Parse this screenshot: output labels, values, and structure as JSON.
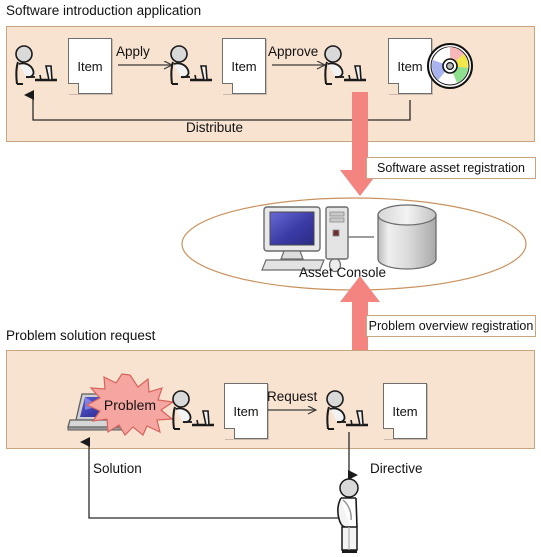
{
  "diagram": {
    "title_top": "Software introduction application",
    "title_bottom": "Problem solution request",
    "colors": {
      "panel_fill": "#f8e3d1",
      "panel_border": "#c9a57e",
      "big_arrow": "#f4847f",
      "ellipse_stroke": "#c9925e",
      "line": "#3a3a3a",
      "doc_fill": "#ffffff",
      "screen_blue": "#3c3ca8",
      "starburst": "#f6a6a0"
    }
  },
  "top_panel": {
    "label": "Software introduction application",
    "nodes": [
      {
        "name": "requester",
        "type": "person-at-desk"
      },
      {
        "name": "item-1",
        "type": "document",
        "label": "Item"
      },
      {
        "name": "apply-arrow",
        "type": "arrow",
        "label": "Apply"
      },
      {
        "name": "approver",
        "type": "person-at-desk"
      },
      {
        "name": "item-2",
        "type": "document",
        "label": "Item"
      },
      {
        "name": "approve-arrow",
        "type": "arrow",
        "label": "Approve"
      },
      {
        "name": "administrator",
        "type": "person-at-desk"
      },
      {
        "name": "item-3",
        "type": "document",
        "label": "Item"
      },
      {
        "name": "cd-media",
        "type": "cd-disc"
      }
    ],
    "item_label": "Item",
    "apply_label": "Apply",
    "approve_label": "Approve",
    "distribute_label": "Distribute"
  },
  "center": {
    "asset_console_label": "Asset Console",
    "nodes": [
      {
        "name": "desktop-computer",
        "type": "computer"
      },
      {
        "name": "database",
        "type": "cylinder"
      }
    ]
  },
  "callouts": {
    "software_asset_registration": "Software asset registration",
    "problem_overview_registration": "Problem overview registration"
  },
  "bottom_panel": {
    "label": "Problem solution request",
    "problem_label": "Problem",
    "item_label": "Item",
    "request_label": "Request",
    "solution_label": "Solution",
    "directive_label": "Directive",
    "nodes": [
      {
        "name": "laptop",
        "type": "laptop"
      },
      {
        "name": "problem-burst",
        "type": "starburst",
        "label": "Problem"
      },
      {
        "name": "end-user",
        "type": "person-at-desk"
      },
      {
        "name": "item-1",
        "type": "document",
        "label": "Item"
      },
      {
        "name": "helpdesk-operator",
        "type": "person-at-desk"
      },
      {
        "name": "item-2",
        "type": "document",
        "label": "Item"
      },
      {
        "name": "support-engineer",
        "type": "person-standing"
      }
    ]
  }
}
